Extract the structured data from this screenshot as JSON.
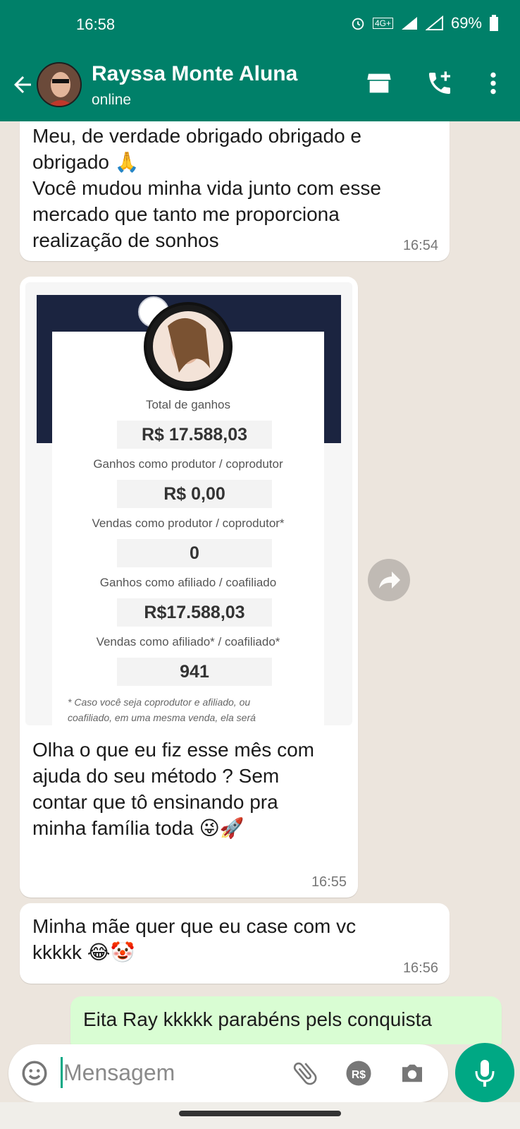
{
  "status_bar": {
    "time": "16:58",
    "network": "4G+",
    "battery": "69%"
  },
  "header": {
    "contact_name": "Rayssa Monte Aluna",
    "status": "online",
    "icons": [
      "back-arrow-icon",
      "store-icon",
      "add-call-icon",
      "more-vert-icon"
    ]
  },
  "messages": [
    {
      "side": "incoming",
      "text_lines": [
        "Meu, de verdade obrigado obrigado e",
        "obrigado 🙏",
        "Você mudou minha vida junto com esse",
        "mercado que tanto me proporciona",
        "realização de sonhos"
      ],
      "time": "16:54"
    },
    {
      "side": "incoming",
      "image": {
        "total_label": "Total de ganhos",
        "total_value": "R$ 17.588,03",
        "producer_label": "Ganhos como produtor / coprodutor",
        "producer_value": "R$ 0,00",
        "producer_sales_label": "Vendas como produtor / coprodutor*",
        "producer_sales_value": "0",
        "affiliate_label": "Ganhos como afiliado / coafiliado",
        "affiliate_value": "R$17.588,03",
        "affiliate_sales_label": "Vendas como afiliado* / coafiliado*",
        "affiliate_sales_value": "941",
        "note_line1": "* Caso você seja coprodutor e afiliado, ou",
        "note_line2": "coafiliado, em uma mesma venda, ela será"
      },
      "caption_lines": [
        "Olha o que eu fiz esse mês com",
        "ajuda do seu método ? Sem",
        "contar que tô ensinando pra",
        "minha família toda 😜🚀"
      ],
      "time": "16:55"
    },
    {
      "side": "incoming",
      "text_lines": [
        "Minha mãe quer que eu case com vc",
        "kkkkk 😂🤡"
      ],
      "time": "16:56"
    },
    {
      "side": "outgoing",
      "text_lines": [
        "Eita Ray kkkkk parabéns pels conquista"
      ]
    }
  ],
  "composer": {
    "placeholder": "Mensagem",
    "icons": [
      "emoji-icon",
      "attach-icon",
      "payment-icon",
      "camera-icon",
      "mic-icon"
    ]
  },
  "colors": {
    "header": "#008069",
    "chat_bg": "#ece5dd",
    "outgoing_bubble": "#d9fdd3",
    "accent": "#00a884"
  }
}
